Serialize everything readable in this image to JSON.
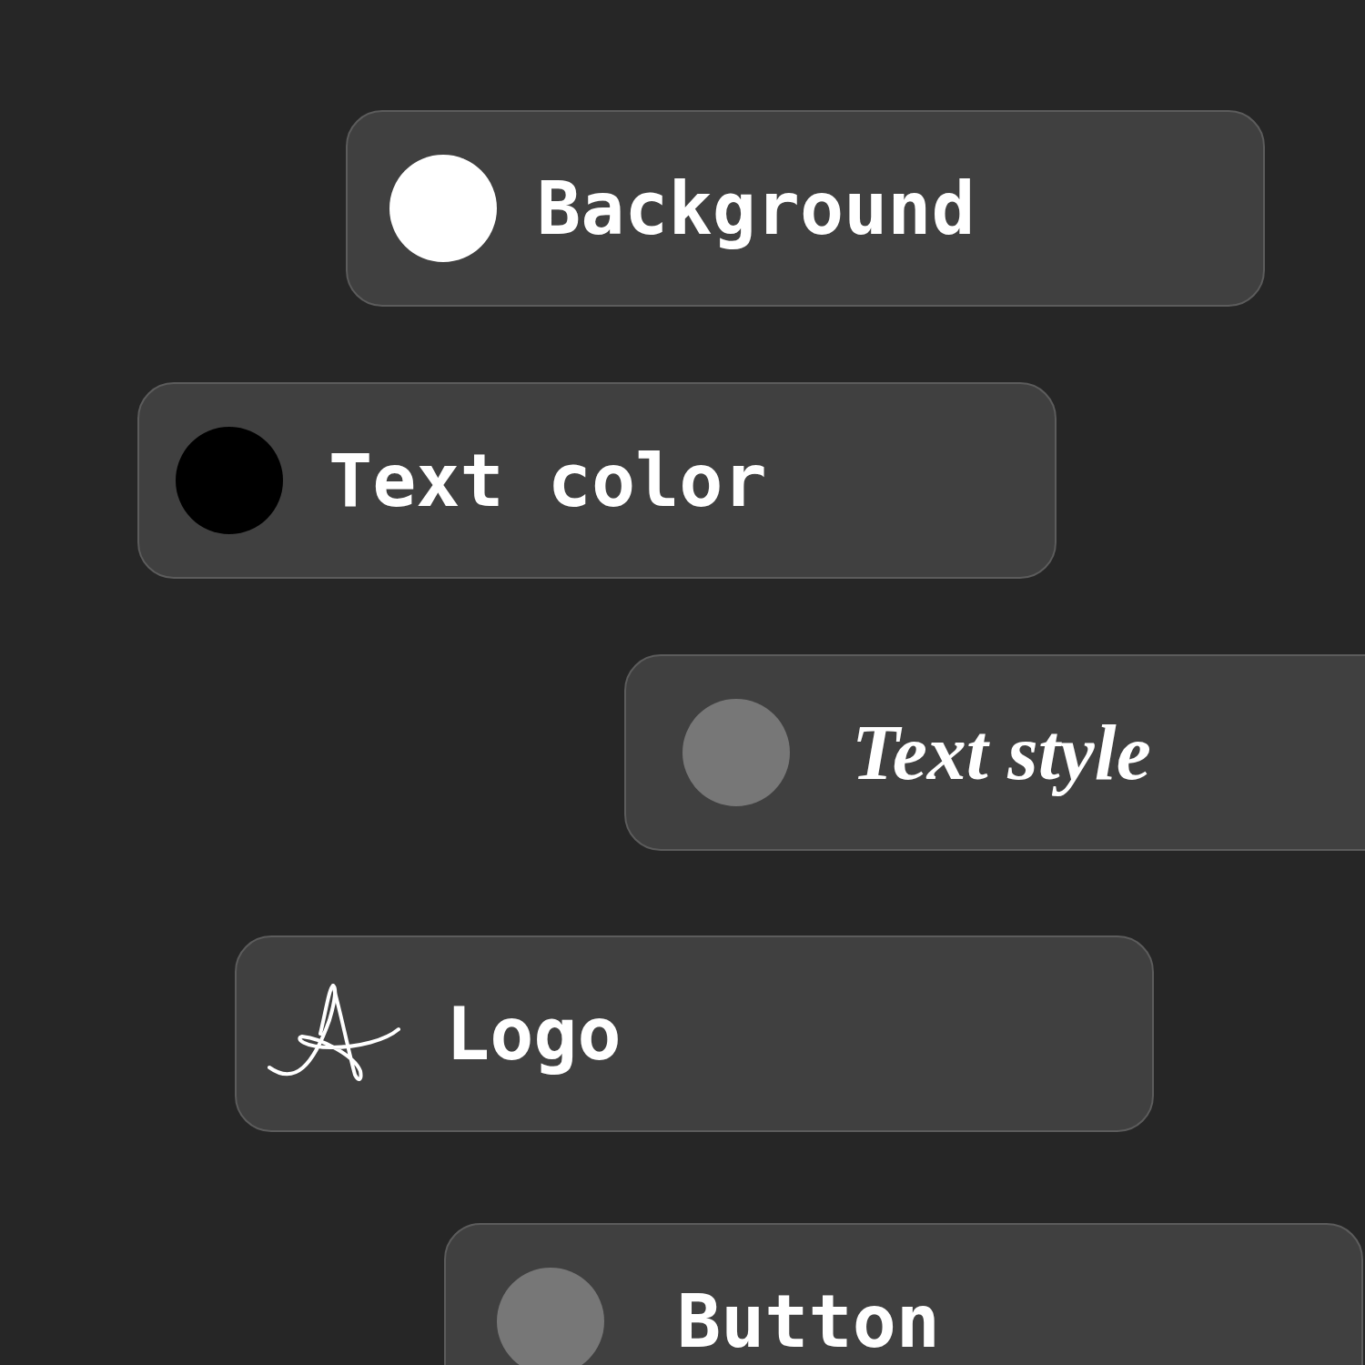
{
  "items": [
    {
      "kind": "swatch",
      "label": "Background",
      "color": "#ffffff"
    },
    {
      "kind": "swatch",
      "label": "Text color",
      "color": "#000000"
    },
    {
      "kind": "styled",
      "label": "Text style",
      "color": "#777777"
    },
    {
      "kind": "logo",
      "label": "Logo"
    },
    {
      "kind": "swatch",
      "label": "Button",
      "color": "#777777"
    }
  ]
}
